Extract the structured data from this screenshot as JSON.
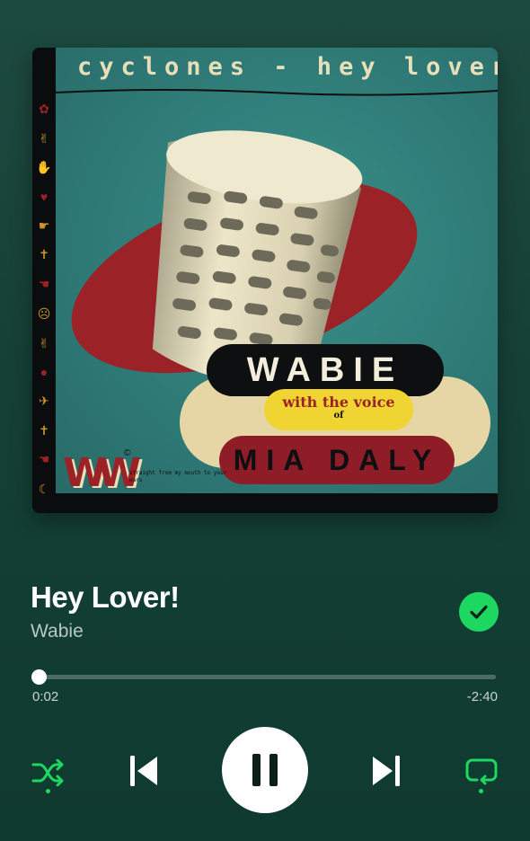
{
  "album_art": {
    "header_text": "cyclones - hey lover",
    "band_name": "WABIE",
    "with_text": "with the voice",
    "of_text": "of",
    "featured_name": "MIA DALY",
    "logo_text": "W",
    "copyright": "©",
    "tagline": "straight from my mouth to your ears"
  },
  "track": {
    "title": "Hey Lover!",
    "artist": "Wabie",
    "saved": true
  },
  "playback": {
    "elapsed": "0:02",
    "remaining": "-2:40",
    "progress_fraction": 0.012,
    "state": "playing"
  },
  "controls": {
    "shuffle_active": true,
    "repeat_active": true,
    "icons": [
      "shuffle-icon",
      "previous-icon",
      "pause-icon",
      "next-icon",
      "repeat-icon"
    ]
  },
  "colors": {
    "accent": "#1ed760",
    "background_top": "#1d4a40",
    "background_bottom": "#0f3a2f",
    "progress_track": "#4f6c64"
  }
}
